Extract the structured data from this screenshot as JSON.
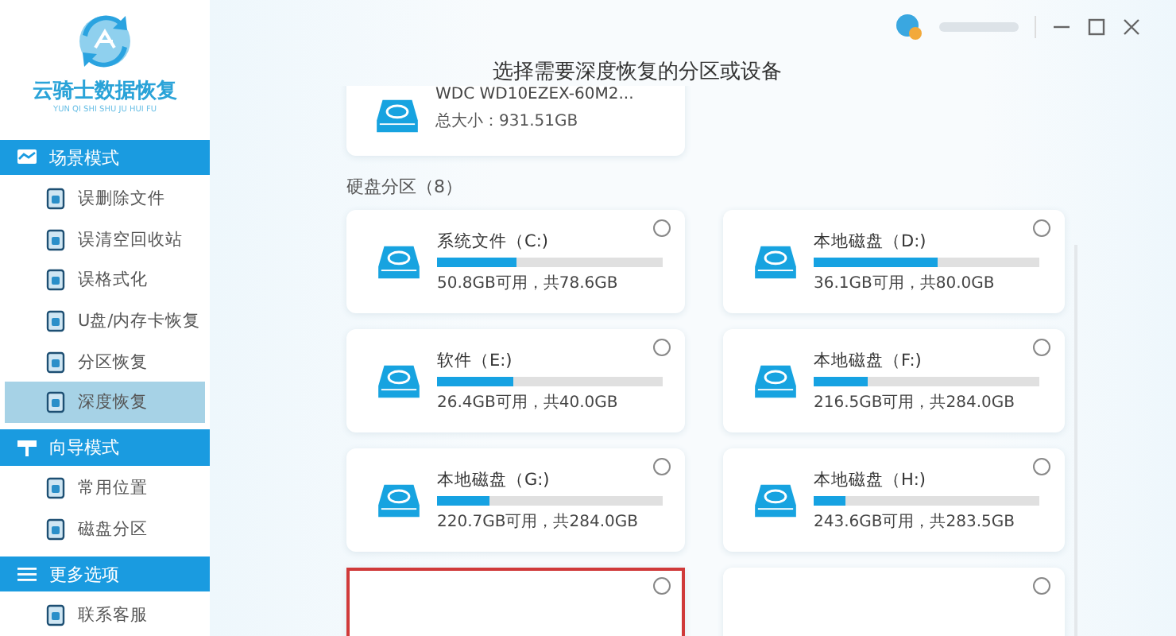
{
  "app": {
    "name": "云骑士数据恢复",
    "pinyin": "YUN QI SHI SHU JU HUI FU"
  },
  "sidebar": {
    "sections": [
      {
        "title": "场景模式",
        "items": [
          {
            "label": "误删除文件",
            "selected": false
          },
          {
            "label": "误清空回收站",
            "selected": false
          },
          {
            "label": "误格式化",
            "selected": false
          },
          {
            "label": "U盘/内存卡恢复",
            "selected": false
          },
          {
            "label": "分区恢复",
            "selected": false
          },
          {
            "label": "深度恢复",
            "selected": true
          }
        ]
      },
      {
        "title": "向导模式",
        "items": [
          {
            "label": "常用位置",
            "selected": false
          },
          {
            "label": "磁盘分区",
            "selected": false
          }
        ]
      },
      {
        "title": "更多选项",
        "items": [
          {
            "label": "联系客服",
            "selected": false
          }
        ]
      }
    ]
  },
  "main": {
    "title": "选择需要深度恢复的分区或设备",
    "disk": {
      "name": "WDC WD10EZEX-60M2...",
      "size": "总大小：931.51GB"
    },
    "partitions_heading": "硬盘分区（8）",
    "partitions": [
      {
        "name": "系统文件（C:)",
        "usage": "50.8GB可用，共78.6GB",
        "level": 0.35,
        "selected": false,
        "highlighted": false
      },
      {
        "name": "本地磁盘（D:)",
        "usage": "36.1GB可用，共80.0GB",
        "level": 0.55,
        "selected": false,
        "highlighted": false
      },
      {
        "name": "软件（E:)",
        "usage": "26.4GB可用，共40.0GB",
        "level": 0.34,
        "selected": false,
        "highlighted": false
      },
      {
        "name": "本地磁盘（F:)",
        "usage": "216.5GB可用，共284.0GB",
        "level": 0.24,
        "selected": false,
        "highlighted": false
      },
      {
        "name": "本地磁盘（G:)",
        "usage": "220.7GB可用，共284.0GB",
        "level": 0.23,
        "selected": false,
        "highlighted": false
      },
      {
        "name": "本地磁盘（H:)",
        "usage": "243.6GB可用，共283.5GB",
        "level": 0.14,
        "selected": false,
        "highlighted": false
      },
      {
        "selected": false,
        "highlighted": true
      },
      {
        "selected": false,
        "highlighted": false
      }
    ]
  }
}
